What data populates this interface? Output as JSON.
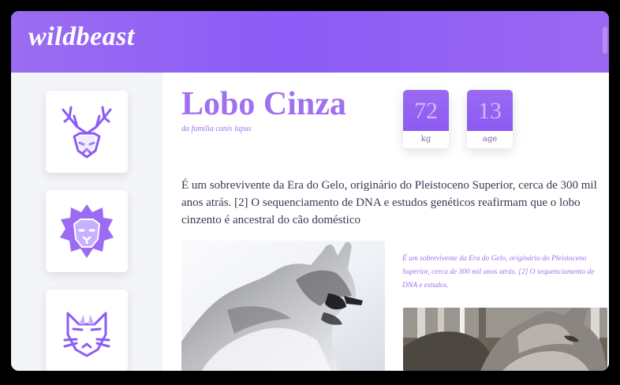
{
  "app": {
    "brand": "wildbeast"
  },
  "sidebar": {
    "items": [
      {
        "name": "deer",
        "icon": "deer-icon"
      },
      {
        "name": "lion",
        "icon": "lion-icon"
      },
      {
        "name": "fox",
        "icon": "fox-icon"
      }
    ]
  },
  "animal": {
    "title": "Lobo Cinza",
    "subtitle": "da família canis lupus",
    "stats": {
      "weight_value": "72",
      "weight_unit": "kg",
      "age_value": "13",
      "age_unit": "age"
    },
    "description": "É um sobrevivente da Era do Gelo, originário do Pleistoceno Superior, cerca de 300 mil anos atrás. [2] O sequenciamento de DNA e estudos genéticos reafirmam que o lobo cinzento é ancestral do cão doméstico",
    "caption": "É um sobrevivente da Era do Gelo, originário do Pleistoceno Superior, cerca de 300 mil anos atrás. [2] O sequenciamento de DNA e estudos."
  },
  "colors": {
    "accent": "#8b5cf6",
    "accent_light": "#a070ef",
    "sidebar_bg": "#f4f5f9",
    "text": "#3a3850"
  }
}
